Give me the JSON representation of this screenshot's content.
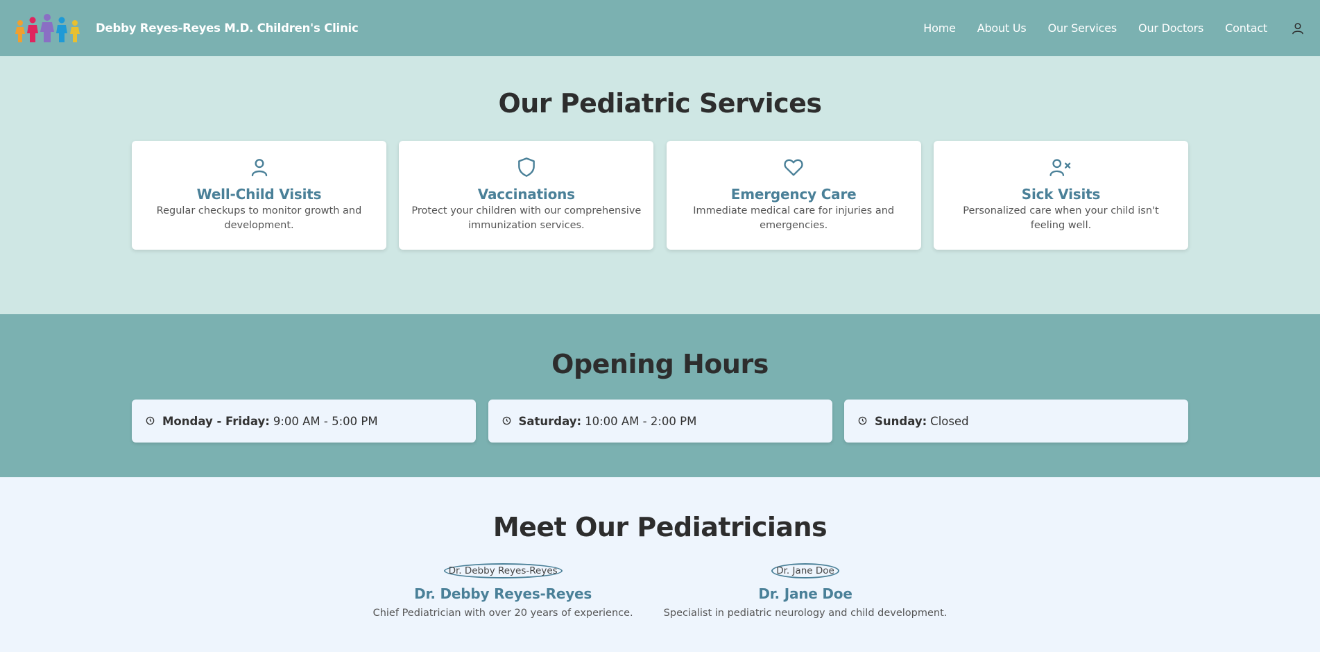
{
  "header": {
    "brand": "Debby Reyes-Reyes M.D. Children's Clinic",
    "nav": [
      "Home",
      "About Us",
      "Our Services",
      "Our Doctors",
      "Contact"
    ]
  },
  "services": {
    "title": "Our Pediatric Services",
    "cards": [
      {
        "icon": "user-icon",
        "title": "Well-Child Visits",
        "desc": "Regular checkups to monitor growth and development."
      },
      {
        "icon": "shield-icon",
        "title": "Vaccinations",
        "desc": "Protect your children with our comprehensive immunization services."
      },
      {
        "icon": "heart-icon",
        "title": "Emergency Care",
        "desc": "Immediate medical care for injuries and emergencies."
      },
      {
        "icon": "user-x-icon",
        "title": "Sick Visits",
        "desc": "Personalized care when your child isn't feeling well."
      }
    ]
  },
  "hours": {
    "title": "Opening Hours",
    "items": [
      {
        "day": "Monday - Friday:",
        "time": "9:00 AM - 5:00 PM"
      },
      {
        "day": "Saturday:",
        "time": "10:00 AM - 2:00 PM"
      },
      {
        "day": "Sunday:",
        "time": "Closed"
      }
    ]
  },
  "doctors": {
    "title": "Meet Our Pediatricians",
    "items": [
      {
        "photo_alt": "Dr. Debby Reyes-Reyes",
        "name": "Dr. Debby Reyes-Reyes",
        "desc": "Chief Pediatrician with over 20 years of experience."
      },
      {
        "photo_alt": "Dr. Jane Doe",
        "name": "Dr. Jane Doe",
        "desc": "Specialist in pediatric neurology and child development."
      }
    ]
  },
  "colors": {
    "header_bg": "#7bb1b1",
    "services_bg": "#cfe7e4",
    "accent": "#4a8098",
    "page_bg": "#eef5fd"
  }
}
